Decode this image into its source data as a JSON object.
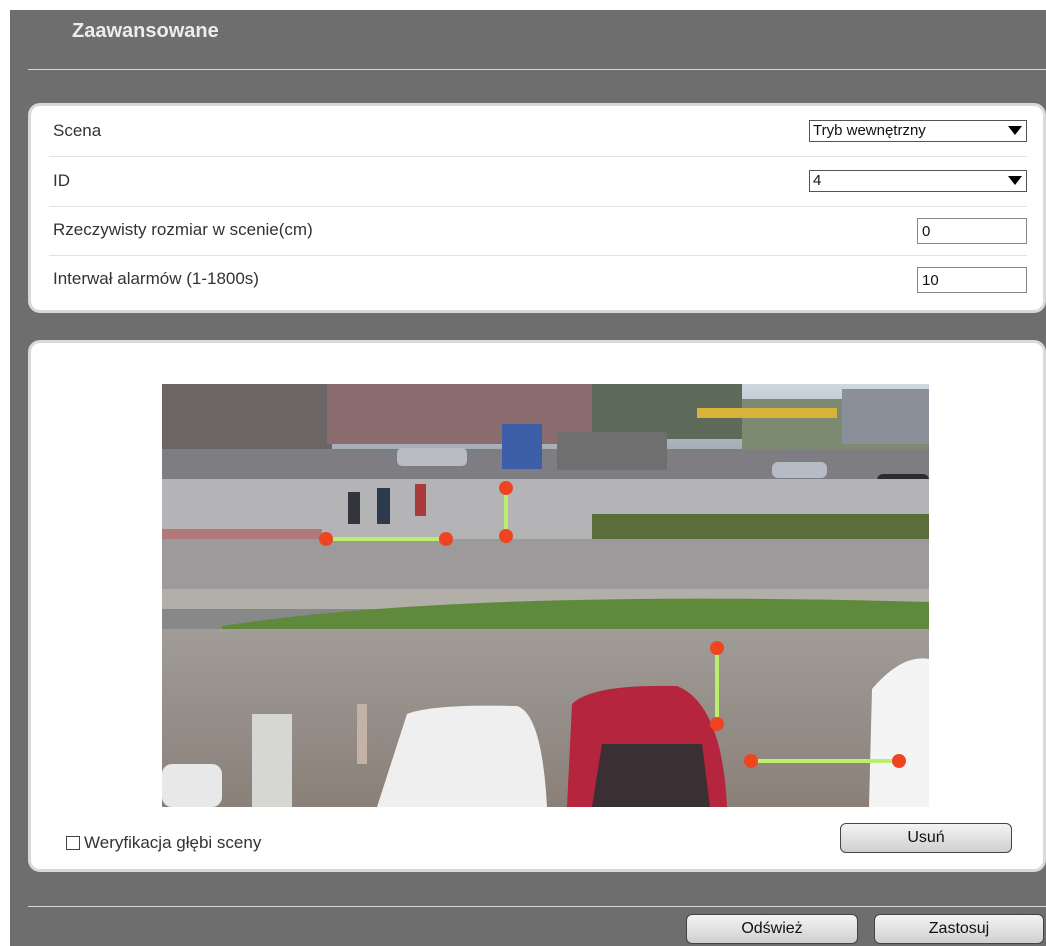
{
  "page_title": "Zaawansowane",
  "settings": {
    "scene": {
      "label": "Scena",
      "value": "Tryb wewnętrzny"
    },
    "id": {
      "label": "ID",
      "value": "4"
    },
    "real_size": {
      "label": "Rzeczywisty rozmiar w scenie(cm)",
      "value": "0"
    },
    "alarm_interval": {
      "label": "Interwał alarmów (1-1800s)",
      "value": "10"
    }
  },
  "canvas": {
    "depth_check_label": "Weryfikacja głębi sceny",
    "depth_check_checked": false,
    "delete_button": "Usuń"
  },
  "footer": {
    "refresh_button": "Odśwież",
    "apply_button": "Zastosuj"
  },
  "colors": {
    "marker_line": "#b8f06e",
    "marker_point": "#ee4422"
  }
}
